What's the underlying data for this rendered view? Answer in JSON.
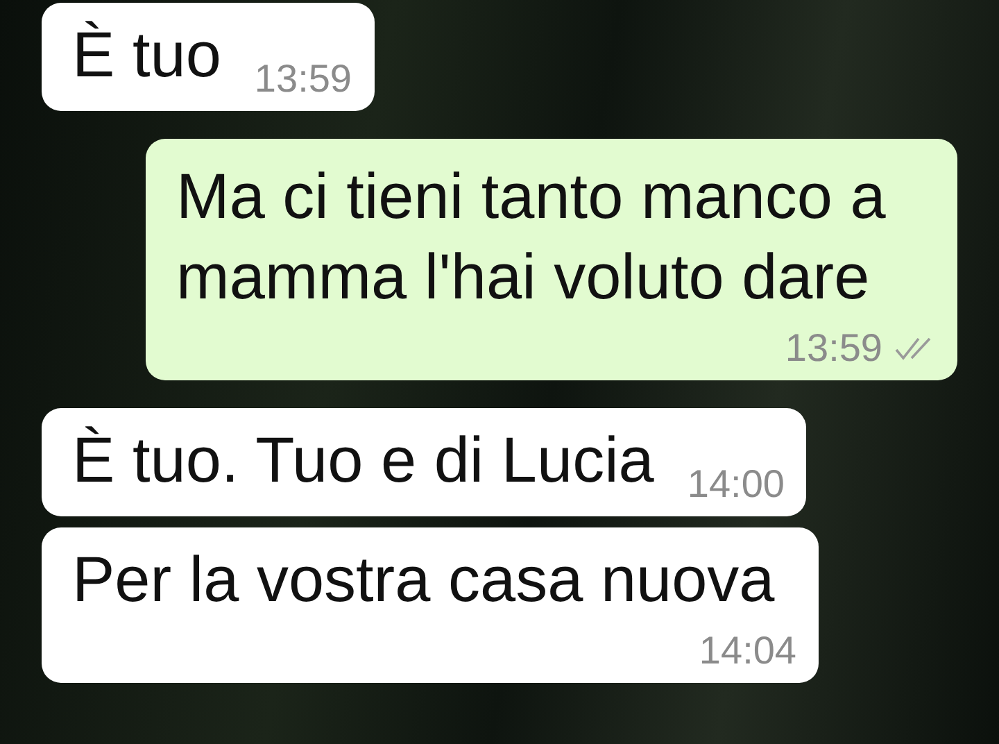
{
  "messages": [
    {
      "kind": "incoming",
      "text": "È tuo",
      "time": "13:59"
    },
    {
      "kind": "outgoing",
      "text": "Ma ci tieni tanto manco a mamma l'hai voluto dare",
      "time": "13:59",
      "read": false
    },
    {
      "kind": "incoming",
      "text": "È tuo. Tuo e di Lucia",
      "time": "14:00"
    },
    {
      "kind": "incoming",
      "text": "Per la vostra casa nuova",
      "time": "14:04"
    }
  ]
}
